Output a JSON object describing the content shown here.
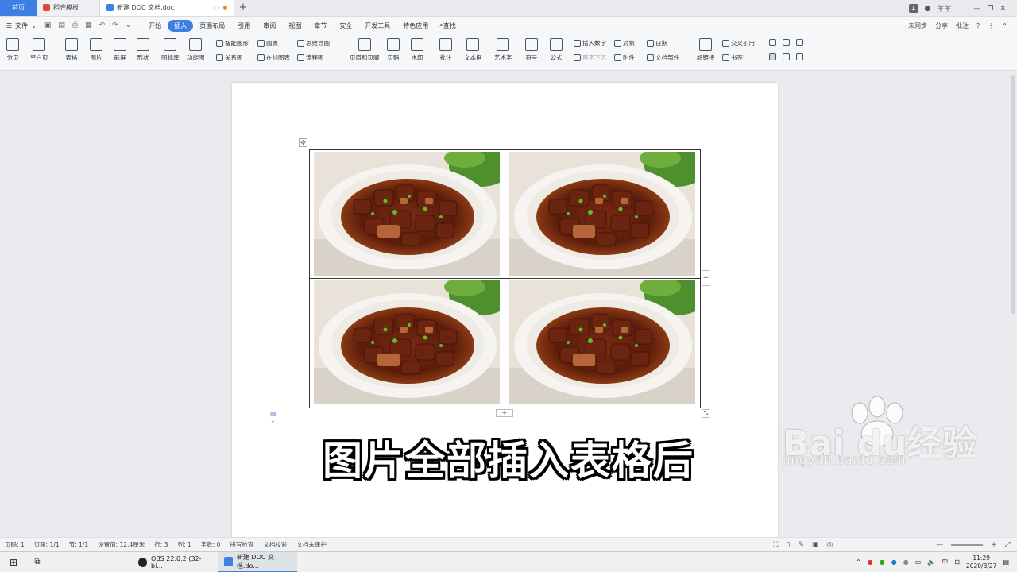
{
  "tabs": {
    "home": "首页",
    "template": "稻壳模板",
    "document": "新建 DOC 文档.doc"
  },
  "window": {
    "badge": "1",
    "user": "羊羊"
  },
  "menu": {
    "file": "文件",
    "tabs": [
      "开始",
      "插入",
      "页面布局",
      "引用",
      "审阅",
      "视图",
      "章节",
      "安全",
      "开发工具",
      "特色应用"
    ],
    "active_tab": "插入",
    "search": "查找",
    "sync": "未同步",
    "share": "分享",
    "comment": "批注"
  },
  "ribbon": {
    "page_break": "分页",
    "blank_page": "空白页",
    "table": "表格",
    "picture": "图片",
    "screenshot": "截屏",
    "shape": "形状",
    "icon_lib": "图标库",
    "func_chart": "功能图",
    "smart_art": "智能图形",
    "chart": "图表",
    "mind_map": "思维导图",
    "relation": "关系图",
    "online_chart": "在线图表",
    "flow_chart": "流程图",
    "header_footer": "页眉和页脚",
    "page_number": "页码",
    "watermark": "水印",
    "annotation": "批注",
    "text_box": "文本框",
    "word_art": "艺术字",
    "symbol": "符号",
    "formula": "公式",
    "insert_number": "插入数字",
    "first_char_sink": "首字下沉",
    "object": "对象",
    "attachment": "附件",
    "date": "日期",
    "doc_parts": "文档部件",
    "hyperlink": "超链接",
    "cross_ref": "交叉引用",
    "bookmark": "书签"
  },
  "caption": "图片全部插入表格后",
  "baidu": {
    "brand": "Bai du经验",
    "url": "jingyan.baidu.com"
  },
  "status": {
    "page_num": "页码: 1",
    "page_of": "页面: 1/1",
    "section": "节: 1/1",
    "setting": "设置值: 12.4厘米",
    "row": "行: 3",
    "col": "列: 1",
    "words": "字数: 0",
    "spell": "拼写检查",
    "proof": "文档校对",
    "protect": "文档未保护"
  },
  "taskbar": {
    "obs": "OBS 22.0.2 (32-bi...",
    "wps": "新建 DOC 文档.do...",
    "ime": "中",
    "time": "11:29",
    "date": "2020/3/27"
  }
}
